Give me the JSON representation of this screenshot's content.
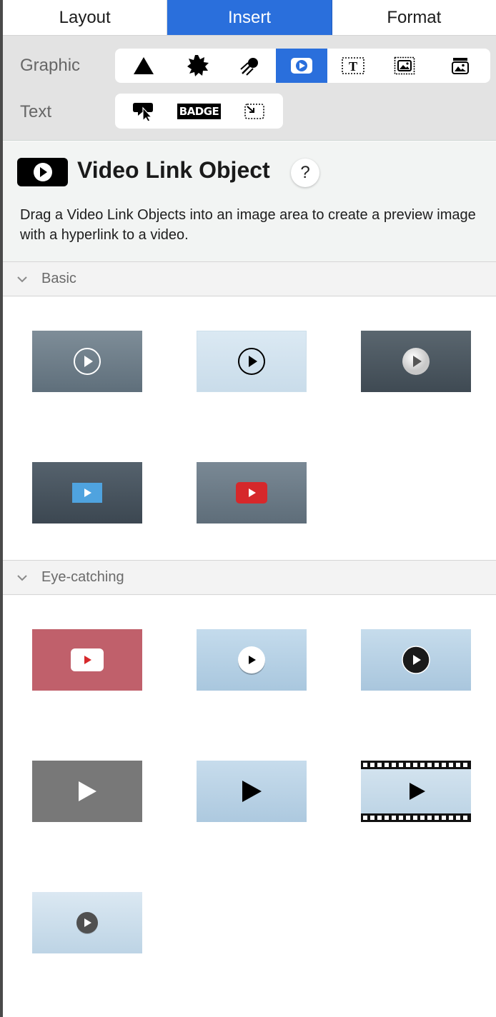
{
  "tabs": [
    {
      "label": "Layout",
      "active": false
    },
    {
      "label": "Insert",
      "active": true
    },
    {
      "label": "Format",
      "active": false
    }
  ],
  "insert_bar": {
    "graphic_label": "Graphic",
    "text_label": "Text",
    "graphic_items": [
      "triangle-shape-icon",
      "starburst-icon",
      "comet-icon",
      "video-link-icon",
      "text-box-icon",
      "image-frame-icon",
      "image-caption-icon"
    ],
    "graphic_selected": "video-link-icon",
    "text_items": [
      "speech-bubble-cursor-icon",
      "badge-icon",
      "dotted-resize-icon"
    ],
    "badge_text": "BADGE"
  },
  "header": {
    "title": "Video Link Object",
    "help_label": "?",
    "description": "Drag a Video Link Objects into an image area to create a preview image with a hyperlink to a video."
  },
  "sections": {
    "basic": {
      "title": "Basic",
      "thumbs": [
        "basic-grey-circle-play",
        "basic-light-outline-play",
        "basic-dark-white-disc-play",
        "basic-dark-blue-rect-play",
        "basic-grey-red-rect-play"
      ]
    },
    "eye_catching": {
      "title": "Eye-catching",
      "thumbs": [
        "eye-red-white-rect-play",
        "eye-blue-white-disc-play",
        "eye-blue-black-disc-play",
        "eye-grey-white-triangle",
        "eye-blue-black-triangle",
        "eye-filmstrip-play",
        "eye-light-grey-disc-play"
      ]
    }
  },
  "colors": {
    "accent": "#2a6fdc",
    "youtube_red": "#d6282b",
    "blue_button": "#4fa3df"
  }
}
